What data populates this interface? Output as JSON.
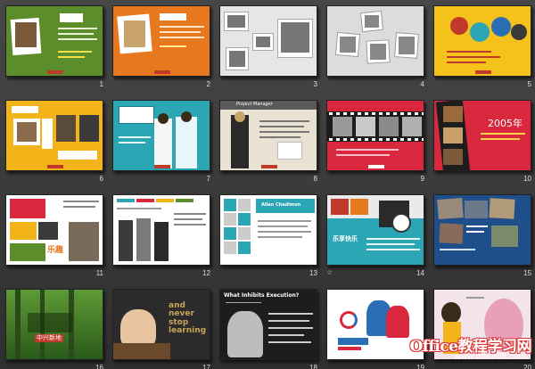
{
  "window": {
    "view": "slide-sorter"
  },
  "slides": [
    {
      "number": "1",
      "bg": "#5b8d2a",
      "text_a": "",
      "text_b": ""
    },
    {
      "number": "2",
      "bg": "#e8781e",
      "text_a": "",
      "text_b": ""
    },
    {
      "number": "3",
      "bg": "#e6e6e6",
      "text_a": "",
      "text_b": ""
    },
    {
      "number": "4",
      "bg": "#dcdcdc",
      "text_a": "",
      "text_b": ""
    },
    {
      "number": "5",
      "bg": "#f4c21a",
      "text_a": "",
      "text_b": ""
    },
    {
      "number": "6",
      "bg": "#f2b418",
      "text_a": "",
      "text_b": ""
    },
    {
      "number": "7",
      "bg": "#2aa6b5",
      "text_a": "",
      "text_b": ""
    },
    {
      "number": "8",
      "bg": "#e9e2d2",
      "text_a": "Project Manager",
      "text_b": ""
    },
    {
      "number": "9",
      "bg": "#d9273d",
      "text_a": "",
      "text_b": ""
    },
    {
      "number": "10",
      "bg": "#d9273d",
      "text_a": "2005年",
      "text_b": ""
    },
    {
      "number": "11",
      "bg": "#ffffff",
      "text_a": "乐趣",
      "text_b": ""
    },
    {
      "number": "12",
      "bg": "#ffffff",
      "text_a": "",
      "text_b": ""
    },
    {
      "number": "13",
      "bg": "#ffffff",
      "text_a": "Allan Chadimon",
      "text_b": ""
    },
    {
      "number": "14",
      "bg": "#2aa6b5",
      "text_a": "乐享快乐",
      "text_b": ""
    },
    {
      "number": "15",
      "bg": "#1e4f8a",
      "text_a": "",
      "text_b": ""
    },
    {
      "number": "16",
      "bg": "#3d7a2a",
      "text_a": "中兴新地",
      "text_b": ""
    },
    {
      "number": "17",
      "bg": "#2b2b2b",
      "text_a": "and never stop learning",
      "text_b": ""
    },
    {
      "number": "18",
      "bg": "#1d1d1d",
      "text_a": "What Inhibits Execution?",
      "text_b": ""
    },
    {
      "number": "19",
      "bg": "#ffffff",
      "text_a": "",
      "text_b": ""
    },
    {
      "number": "20",
      "bg": "#f3e3ea",
      "text_a": "",
      "text_b": ""
    }
  ],
  "watermark": {
    "title": "Office教程学习网",
    "url": "www.office68.com"
  }
}
